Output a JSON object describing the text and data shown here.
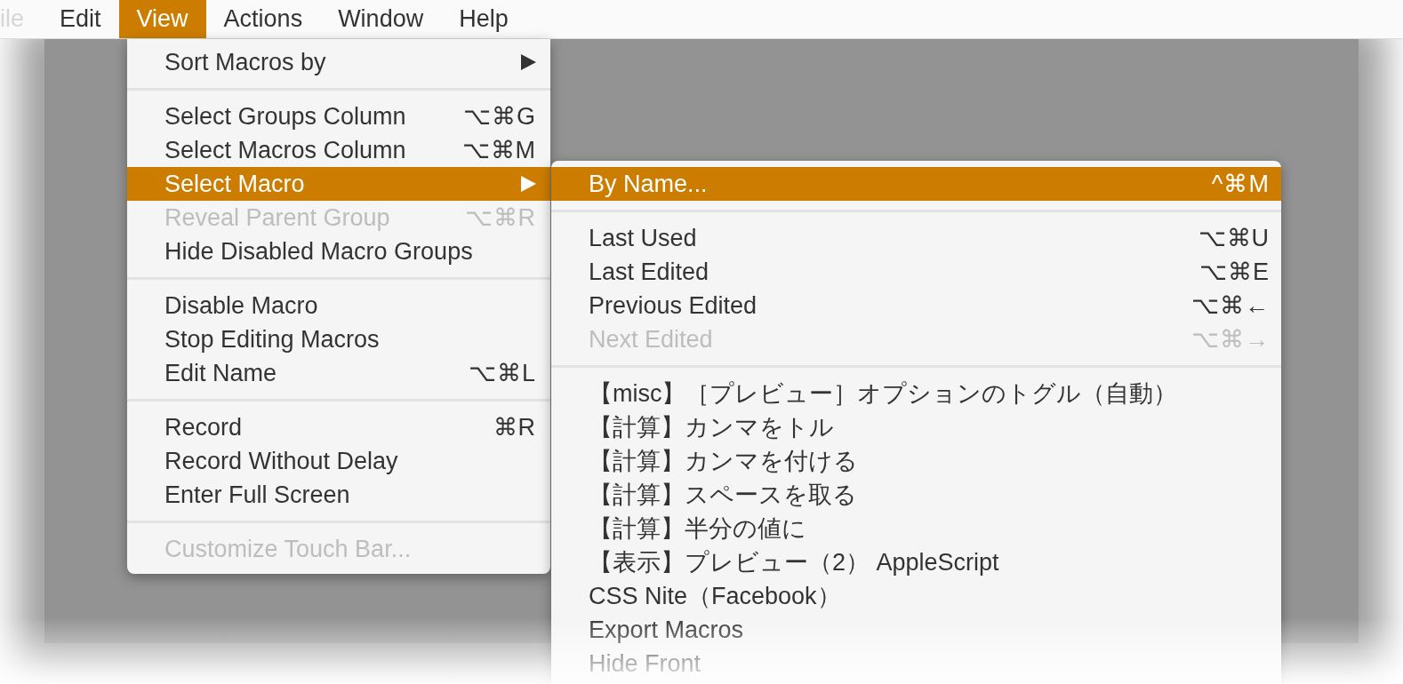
{
  "menu_bar": [
    {
      "label": "ile",
      "selected": false,
      "faded": true
    },
    {
      "label": "Edit",
      "selected": false,
      "faded": false
    },
    {
      "label": "View",
      "selected": true,
      "faded": false
    },
    {
      "label": "Actions",
      "selected": false,
      "faded": false
    },
    {
      "label": "Window",
      "selected": false,
      "faded": false
    },
    {
      "label": "Help",
      "selected": false,
      "faded": false
    }
  ],
  "view_menu": [
    {
      "kind": "item",
      "label": "Sort Macros by",
      "submenu": true,
      "selected": false,
      "disabled": false
    },
    {
      "kind": "separator"
    },
    {
      "kind": "item",
      "label": "Select Groups Column",
      "shortcut": "⌥⌘G",
      "selected": false,
      "disabled": false
    },
    {
      "kind": "item",
      "label": "Select Macros Column",
      "shortcut": "⌥⌘M",
      "selected": false,
      "disabled": false
    },
    {
      "kind": "item",
      "label": "Select Macro",
      "submenu": true,
      "selected": true,
      "disabled": false
    },
    {
      "kind": "item",
      "label": "Reveal Parent Group",
      "shortcut": "⌥⌘R",
      "selected": false,
      "disabled": true
    },
    {
      "kind": "item",
      "label": "Hide Disabled Macro Groups",
      "selected": false,
      "disabled": false
    },
    {
      "kind": "separator"
    },
    {
      "kind": "item",
      "label": "Disable Macro",
      "selected": false,
      "disabled": false
    },
    {
      "kind": "item",
      "label": "Stop Editing Macros",
      "selected": false,
      "disabled": false
    },
    {
      "kind": "item",
      "label": "Edit Name",
      "shortcut": "⌥⌘L",
      "selected": false,
      "disabled": false
    },
    {
      "kind": "separator"
    },
    {
      "kind": "item",
      "label": "Record",
      "shortcut": "⌘R",
      "selected": false,
      "disabled": false
    },
    {
      "kind": "item",
      "label": "Record Without Delay",
      "selected": false,
      "disabled": false
    },
    {
      "kind": "item",
      "label": "Enter Full Screen",
      "selected": false,
      "disabled": false
    },
    {
      "kind": "separator"
    },
    {
      "kind": "item",
      "label": "Customize Touch Bar...",
      "selected": false,
      "disabled": true
    }
  ],
  "select_macro_submenu": [
    {
      "kind": "item",
      "label": "By Name...",
      "shortcut": "^⌘M",
      "selected": true,
      "disabled": false
    },
    {
      "kind": "separator"
    },
    {
      "kind": "item",
      "label": "Last Used",
      "shortcut": "⌥⌘U",
      "selected": false,
      "disabled": false
    },
    {
      "kind": "item",
      "label": "Last Edited",
      "shortcut": "⌥⌘E",
      "selected": false,
      "disabled": false
    },
    {
      "kind": "item",
      "label": "Previous Edited",
      "shortcut": "⌥⌘←",
      "selected": false,
      "disabled": false
    },
    {
      "kind": "item",
      "label": "Next Edited",
      "shortcut": "⌥⌘→",
      "selected": false,
      "disabled": true
    },
    {
      "kind": "separator"
    },
    {
      "kind": "item",
      "label": "【misc】［プレビュー］オプションのトグル（自動）",
      "selected": false,
      "disabled": false
    },
    {
      "kind": "item",
      "label": "【計算】カンマをトル",
      "selected": false,
      "disabled": false
    },
    {
      "kind": "item",
      "label": "【計算】カンマを付ける",
      "selected": false,
      "disabled": false
    },
    {
      "kind": "item",
      "label": "【計算】スペースを取る",
      "selected": false,
      "disabled": false
    },
    {
      "kind": "item",
      "label": "【計算】半分の値に",
      "selected": false,
      "disabled": false
    },
    {
      "kind": "item",
      "label": "【表示】プレビュー（2） AppleScript",
      "selected": false,
      "disabled": false
    },
    {
      "kind": "item",
      "label": "CSS Nite（Facebook）",
      "selected": false,
      "disabled": false
    },
    {
      "kind": "item",
      "label": "Export Macros",
      "selected": false,
      "disabled": false
    },
    {
      "kind": "item",
      "label": "Hide Front",
      "selected": false,
      "disabled": false
    }
  ]
}
